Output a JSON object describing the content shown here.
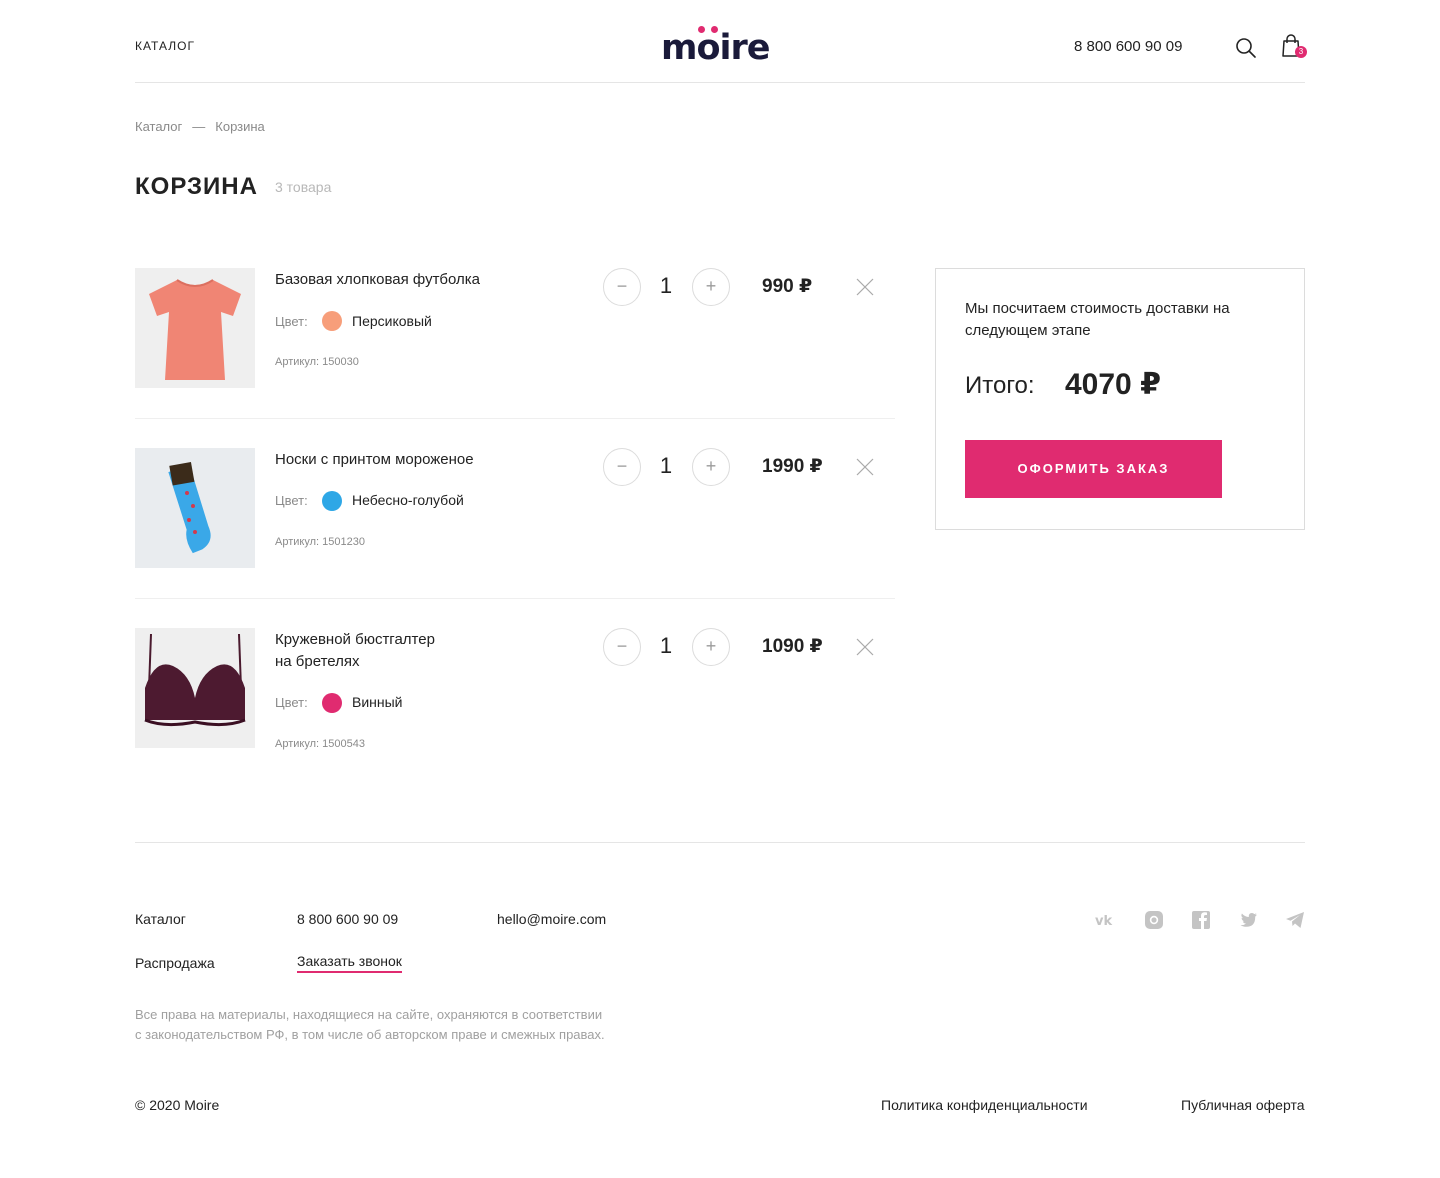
{
  "header": {
    "nav_catalog": "КАТАЛОГ",
    "logo": "moire",
    "phone": "8 800 600 90 09",
    "cart_count": "3"
  },
  "breadcrumb": {
    "items": [
      "Каталог",
      "Корзина"
    ],
    "separator": "—"
  },
  "page": {
    "title": "КОРЗИНА",
    "items_count": "3 товара"
  },
  "cart": {
    "color_label": "Цвет:",
    "sku_prefix": "Артикул:",
    "items": [
      {
        "title": "Базовая хлопковая футболка",
        "color": "Персиковый",
        "color_hex": "#f79e7a",
        "sku": "Артикул: 150030",
        "quantity": "1",
        "price": "990 ₽",
        "image_icon": "peach-t-shirt-photo"
      },
      {
        "title": "Носки с принтом мороженое",
        "color": "Небесно-голубой",
        "color_hex": "#2ea7e6",
        "sku": "Артикул: 1501230",
        "quantity": "1",
        "price": "1990 ₽",
        "image_icon": "blue-socks-photo"
      },
      {
        "title_line1": "Кружевной бюстгалтер",
        "title_line2": "на бретелях",
        "color": "Винный",
        "color_hex": "#e02b70",
        "sku": "Артикул: 1500543",
        "quantity": "1",
        "price": "1090 ₽",
        "image_icon": "wine-lace-bra-photo"
      }
    ],
    "qty_minus_label": "−",
    "qty_plus_label": "+"
  },
  "summary": {
    "delivery_note": "Мы посчитаем стоимость доставки на следующем этапе",
    "total_label": "Итого:",
    "total_value": "4070 ₽",
    "checkout_label": "ОФОРМИТЬ ЗАКАЗ"
  },
  "footer": {
    "catalog": "Каталог",
    "sale": "Распродажа",
    "phone": "8 800 600 90 09",
    "callback": "Заказать звонок",
    "email": "hello@moire.com",
    "social_icons": [
      "vk-icon",
      "instagram-icon",
      "facebook-icon",
      "twitter-icon",
      "telegram-icon"
    ],
    "legal_line1": "Все права на материалы, находящиеся на сайте, охраняются в соответствии",
    "legal_line2": "с законодательством РФ, в том числе об авторском праве и смежных правах.",
    "copyright": "© 2020 Moire",
    "privacy": "Политика конфиденциальности",
    "offer": "Публичная оферта"
  },
  "colors": {
    "accent": "#e02b70",
    "text": "#222222",
    "muted": "#8a8a8a"
  }
}
